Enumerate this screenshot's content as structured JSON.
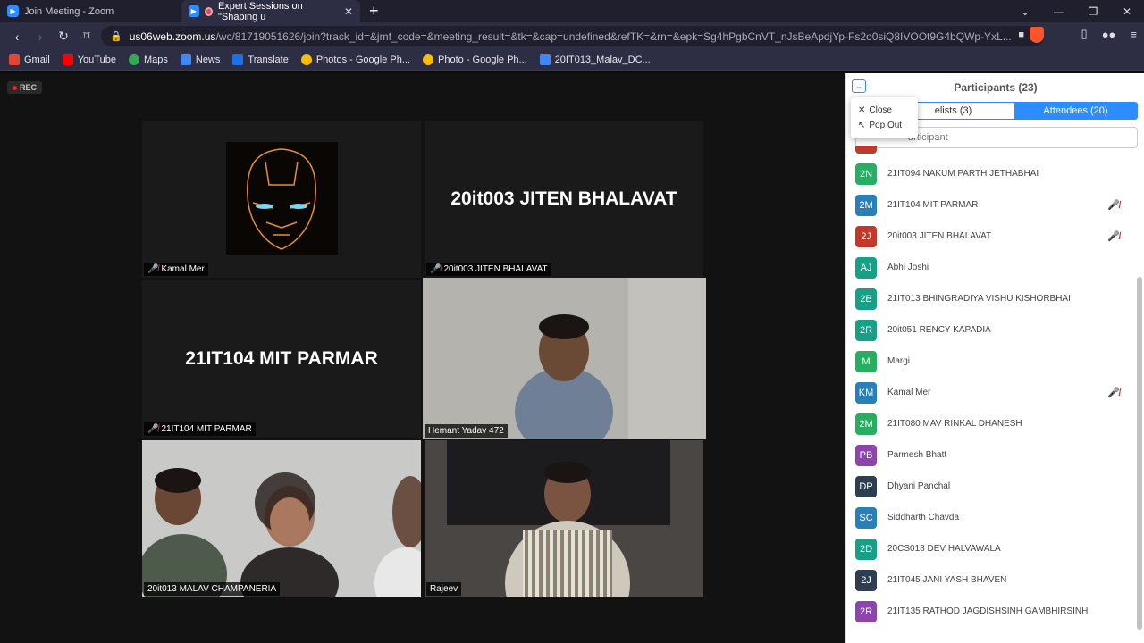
{
  "browser": {
    "tabs": [
      {
        "title": "Join Meeting - Zoom"
      },
      {
        "title": "Expert Sessions on \"Shaping u"
      }
    ],
    "url_host": "us06web.zoom.us",
    "url_rest": "/wc/81719051626/join?track_id=&jmf_code=&meeting_result=&tk=&cap=undefined&refTK=&rn=&epk=Sg4hPgbCnVT_nJsBeApdjYp-Fs2o0siQ8IVOOt9G4bQWp-YxL...",
    "bookmarks": [
      {
        "label": "Gmail",
        "color": "#ea4335"
      },
      {
        "label": "YouTube",
        "color": "#ff0000"
      },
      {
        "label": "Maps",
        "color": "#34a853"
      },
      {
        "label": "News",
        "color": "#4285f4"
      },
      {
        "label": "Translate",
        "color": "#1a73e8"
      },
      {
        "label": "Photos - Google Ph...",
        "color": "#fbbc04"
      },
      {
        "label": "Photo - Google Ph...",
        "color": "#fbbc04"
      },
      {
        "label": "20IT013_Malav_DC...",
        "color": "#4285f4"
      }
    ]
  },
  "meeting": {
    "rec_label": "REC",
    "tiles": [
      {
        "name": "Kamal Mer",
        "big": ""
      },
      {
        "name": "20it003 JITEN BHALAVAT",
        "big": "20it003 JITEN BHALAVAT"
      },
      {
        "name": "21IT104 MIT PARMAR",
        "big": "21IT104 MIT PARMAR"
      },
      {
        "name": "Hemant Yadav 472",
        "big": ""
      },
      {
        "name": "20it013 MALAV CHAMPANERIA",
        "big": ""
      },
      {
        "name": "Rajeev",
        "big": ""
      }
    ]
  },
  "panel": {
    "title": "Participants (23)",
    "tab_panelists": "elists (3)",
    "tab_attendees": "Attendees (20)",
    "search_placeholder": "articipant",
    "menu": {
      "close": "Close",
      "popout": "Pop Out"
    },
    "participants": [
      {
        "initials": "2N",
        "name": "21IT094 NAKUM PARTH JETHABHAI",
        "color": "#27ae60",
        "muted": false
      },
      {
        "initials": "2M",
        "name": "21IT104 MIT PARMAR",
        "color": "#2980b9",
        "muted": true
      },
      {
        "initials": "2J",
        "name": "20it003 JITEN BHALAVAT",
        "color": "#c0392b",
        "muted": true
      },
      {
        "initials": "AJ",
        "name": "Abhi Joshi",
        "color": "#16a085",
        "muted": false
      },
      {
        "initials": "2B",
        "name": "21IT013 BHINGRADIYA VISHU KISHORBHAI",
        "color": "#16a085",
        "muted": false
      },
      {
        "initials": "2R",
        "name": "20it051 RENCY KAPADIA",
        "color": "#16a085",
        "muted": false
      },
      {
        "initials": "M",
        "name": "Margi",
        "color": "#27ae60",
        "muted": false
      },
      {
        "initials": "KM",
        "name": "Kamal Mer",
        "color": "#2980b9",
        "muted": true
      },
      {
        "initials": "2M",
        "name": "21IT080 MAV RINKAL DHANESH",
        "color": "#27ae60",
        "muted": false
      },
      {
        "initials": "PB",
        "name": "Parmesh Bhatt",
        "color": "#8e44ad",
        "muted": false
      },
      {
        "initials": "DP",
        "name": "Dhyani Panchal",
        "color": "#2c3e50",
        "muted": false
      },
      {
        "initials": "SC",
        "name": "Siddharth Chavda",
        "color": "#2980b9",
        "muted": false
      },
      {
        "initials": "2D",
        "name": "20CS018 DEV HALVAWALA",
        "color": "#16a085",
        "muted": false
      },
      {
        "initials": "2J",
        "name": "21IT045 JANI YASH BHAVEN",
        "color": "#2c3e50",
        "muted": false
      },
      {
        "initials": "2R",
        "name": "21IT135 RATHOD JAGDISHSINH GAMBHIRSINH",
        "color": "#8e44ad",
        "muted": false
      }
    ]
  }
}
